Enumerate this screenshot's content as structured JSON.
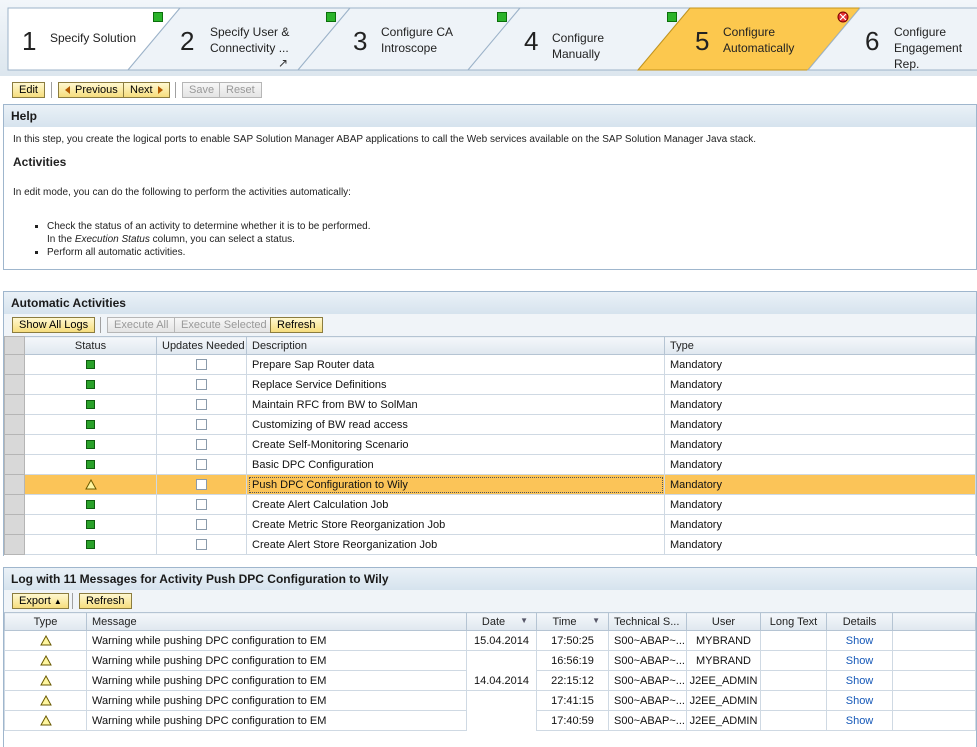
{
  "wizard": {
    "steps": [
      {
        "num": "1",
        "label": "Specify Solution",
        "status": "green"
      },
      {
        "num": "2",
        "label": "Specify User & Connectivity ...",
        "status": "green"
      },
      {
        "num": "3",
        "label": "Configure CA Introscope",
        "status": "green"
      },
      {
        "num": "4",
        "label": "Configure Manually",
        "status": "green"
      },
      {
        "num": "5",
        "label": "Configure Automatically",
        "status": "red",
        "active": true
      },
      {
        "num": "6",
        "label": "Configure Engagement Rep.",
        "status": "none"
      }
    ]
  },
  "toolbar": {
    "edit": "Edit",
    "previous": "Previous",
    "next": "Next",
    "save": "Save",
    "reset": "Reset"
  },
  "help": {
    "title": "Help",
    "intro": "In this step, you create the logical ports to enable SAP Solution Manager ABAP applications to call the Web services available on the SAP Solution Manager Java stack.",
    "activities_title": "Activities",
    "edit_mode": "In edit mode, you can do the following to perform the activities automatically:",
    "bullet1_a": "Check the status of an activity to determine whether it is to be performed.",
    "bullet1_b": "In the ",
    "bullet1_em": "Execution Status",
    "bullet1_c": " column, you can select a status.",
    "bullet2": "Perform all automatic activities."
  },
  "auto": {
    "title": "Automatic Activities",
    "buttons": {
      "show_all_logs": "Show All Logs",
      "execute_all": "Execute All",
      "execute_selected": "Execute Selected",
      "refresh": "Refresh"
    },
    "columns": {
      "status": "Status",
      "updates": "Updates Needed",
      "description": "Description",
      "type": "Type"
    },
    "rows": [
      {
        "status": "green",
        "description": "Prepare Sap Router data",
        "type": "Mandatory"
      },
      {
        "status": "green",
        "description": "Replace Service Definitions",
        "type": "Mandatory"
      },
      {
        "status": "green",
        "description": "Maintain RFC from BW to SolMan",
        "type": "Mandatory"
      },
      {
        "status": "green",
        "description": "Customizing of BW read access",
        "type": "Mandatory"
      },
      {
        "status": "green",
        "description": "Create Self-Monitoring Scenario",
        "type": "Mandatory"
      },
      {
        "status": "green",
        "description": "Basic DPC Configuration",
        "type": "Mandatory"
      },
      {
        "status": "warning",
        "description": "Push DPC Configuration to Wily",
        "type": "Mandatory",
        "selected": true
      },
      {
        "status": "green",
        "description": "Create Alert Calculation Job",
        "type": "Mandatory"
      },
      {
        "status": "green",
        "description": "Create Metric Store Reorganization Job",
        "type": "Mandatory"
      },
      {
        "status": "green",
        "description": "Create Alert Store Reorganization Job",
        "type": "Mandatory"
      }
    ]
  },
  "log": {
    "title": "Log with 11 Messages for Activity Push DPC Configuration to Wily",
    "buttons": {
      "export": "Export",
      "refresh": "Refresh"
    },
    "columns": {
      "type": "Type",
      "message": "Message",
      "date": "Date",
      "time": "Time",
      "technical": "Technical S...",
      "user": "User",
      "long_text": "Long Text",
      "details": "Details"
    },
    "rows": [
      {
        "message": "Warning while pushing DPC configuration to EM",
        "date": "15.04.2014",
        "time": "17:50:25",
        "technical": "S00~ABAP~...",
        "user": "MYBRAND",
        "details": "Show"
      },
      {
        "message": "Warning while pushing DPC configuration to EM",
        "date": "",
        "time": "16:56:19",
        "technical": "S00~ABAP~...",
        "user": "MYBRAND",
        "details": "Show"
      },
      {
        "message": "Warning while pushing DPC configuration to EM",
        "date": "14.04.2014",
        "time": "22:15:12",
        "technical": "S00~ABAP~...",
        "user": "J2EE_ADMIN",
        "details": "Show"
      },
      {
        "message": "Warning while pushing DPC configuration to EM",
        "date": "",
        "time": "17:41:15",
        "technical": "S00~ABAP~...",
        "user": "J2EE_ADMIN",
        "details": "Show"
      },
      {
        "message": "Warning while pushing DPC configuration to EM",
        "date": "",
        "time": "17:40:59",
        "technical": "S00~ABAP~...",
        "user": "J2EE_ADMIN",
        "details": "Show"
      }
    ]
  }
}
